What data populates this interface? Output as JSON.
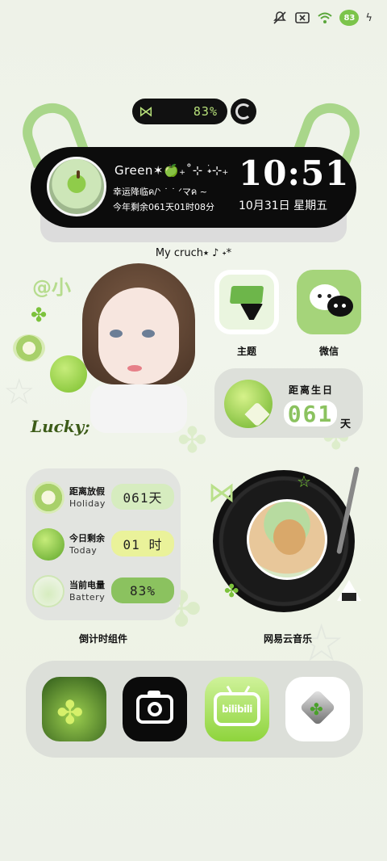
{
  "status_bar": {
    "battery_level": "83",
    "icons": [
      "mute-icon",
      "sim-icon",
      "wifi-icon",
      "battery-icon",
      "charging-icon"
    ]
  },
  "battery_pill": {
    "percent": "83%",
    "icon": "bow-icon"
  },
  "capsule": {
    "line1": "Green✶🍏₊˚⊹ ࣪˖⊹₊",
    "line2": "幸运降临ค/ᐠ ˙ ˙ ᐟマค ~",
    "line3": "今年剩余061天01时08分",
    "time": "10:51",
    "date": "10月31日  星期五"
  },
  "crush_text": "My cruch⭑ ♪ ˖*",
  "portrait": {
    "handle": "@小",
    "lucky": "Lucky;"
  },
  "apps": {
    "theme": {
      "label": "主题",
      "icon": "paint-brush-icon"
    },
    "wechat": {
      "label": "微信",
      "icon": "wechat-icon"
    }
  },
  "birthday": {
    "title": "距离生日",
    "days": "061",
    "unit": "天"
  },
  "countdown": {
    "rows": [
      {
        "title": "距离放假",
        "subtitle": "Holiday",
        "value": "061天"
      },
      {
        "title": "今日剩余",
        "subtitle": "Today",
        "value": "01 时"
      },
      {
        "title": "当前电量",
        "subtitle": "Battery",
        "value": "83%"
      }
    ],
    "label": "倒计时组件"
  },
  "music": {
    "label": "网易云音乐"
  },
  "dock": {
    "apps": [
      "clover-photo-app",
      "camera-app",
      "bilibili-app",
      "heart-clover-app"
    ],
    "bilibili_text": "bilibili"
  },
  "colors": {
    "accent_green": "#8bc25f",
    "light_green": "#a5d47a",
    "pill_text": "#b7e07a",
    "dark": "#0c0c0c"
  }
}
